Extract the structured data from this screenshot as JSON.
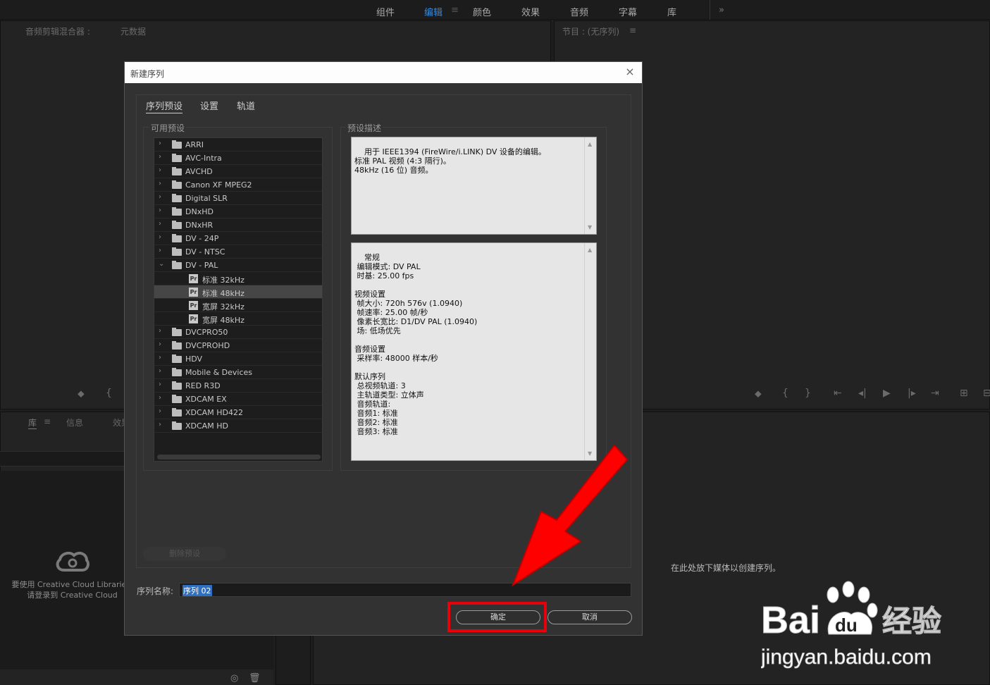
{
  "workspace_tabs": [
    "组件",
    "编辑",
    "颜色",
    "效果",
    "音频",
    "字幕",
    "库"
  ],
  "workspace_active": "编辑",
  "workspace_menu_icon": "≡",
  "workspace_more_icon": "»",
  "source_panel_header": {
    "tab1": "音频剪辑混合器 :",
    "tab2": "元数据"
  },
  "program_panel_header": "节目 : (无序列)",
  "program_menu_icon": "≡",
  "project_panel_tabs": [
    "库",
    "信息",
    "效果"
  ],
  "project_menu_icon": "≡",
  "cc_message": {
    "line1": "要使用 Creative Cloud Libraries,",
    "line2": "请登录到 Creative Cloud"
  },
  "timeline_drop_text": "在此处放下媒体以创建序列。",
  "dialog": {
    "title": "新建序列",
    "close_icon": "×",
    "tabs": [
      "序列预设",
      "设置",
      "轨道"
    ],
    "available_presets_label": "可用预设",
    "preset_description_label": "预设描述",
    "tree_items": [
      {
        "label": "ARRI",
        "type": "folder",
        "expanded": false
      },
      {
        "label": "AVC-Intra",
        "type": "folder",
        "expanded": false
      },
      {
        "label": "AVCHD",
        "type": "folder",
        "expanded": false
      },
      {
        "label": "Canon XF MPEG2",
        "type": "folder",
        "expanded": false
      },
      {
        "label": "Digital SLR",
        "type": "folder",
        "expanded": false
      },
      {
        "label": "DNxHD",
        "type": "folder",
        "expanded": false
      },
      {
        "label": "DNxHR",
        "type": "folder",
        "expanded": false
      },
      {
        "label": "DV - 24P",
        "type": "folder",
        "expanded": false
      },
      {
        "label": "DV - NTSC",
        "type": "folder",
        "expanded": false
      },
      {
        "label": "DV - PAL",
        "type": "folder",
        "expanded": true
      },
      {
        "label": "标准 32kHz",
        "type": "preset",
        "selected": false
      },
      {
        "label": "标准 48kHz",
        "type": "preset",
        "selected": true
      },
      {
        "label": "宽屏 32kHz",
        "type": "preset",
        "selected": false
      },
      {
        "label": "宽屏 48kHz",
        "type": "preset",
        "selected": false
      },
      {
        "label": "DVCPRO50",
        "type": "folder",
        "expanded": false
      },
      {
        "label": "DVCPROHD",
        "type": "folder",
        "expanded": false
      },
      {
        "label": "HDV",
        "type": "folder",
        "expanded": false
      },
      {
        "label": "Mobile & Devices",
        "type": "folder",
        "expanded": false
      },
      {
        "label": "RED R3D",
        "type": "folder",
        "expanded": false
      },
      {
        "label": "XDCAM EX",
        "type": "folder",
        "expanded": false
      },
      {
        "label": "XDCAM HD422",
        "type": "folder",
        "expanded": false
      },
      {
        "label": "XDCAM HD",
        "type": "folder",
        "expanded": false
      }
    ],
    "preset_icon_text": "Pr",
    "description_text": "用于 IEEE1394 (FireWire/i.LINK) DV 设备的编辑。\n标准 PAL 视频 (4:3 隔行)。\n48kHz (16 位) 音频。",
    "details_text": "常规\n 编辑模式: DV PAL\n 时基: 25.00 fps\n\n视频设置\n 帧大小: 720h 576v (1.0940)\n 帧速率: 25.00 帧/秒\n 像素长宽比: D1/DV PAL (1.0940)\n 场: 低场优先\n\n音频设置\n 采样率: 48000 样本/秒\n\n默认序列\n 总视频轨道: 3\n 主轨道类型: 立体声\n 音频轨道:\n 音频1: 标准\n 音频2: 标准\n 音频3: 标准",
    "delete_preset_button": "删除预设",
    "sequence_name_label": "序列名称:",
    "sequence_name_value": "序列 02",
    "ok_button": "确定",
    "cancel_button": "取消"
  },
  "watermark": {
    "brand": "Bai",
    "brand2": "经验",
    "url": "jingyan.baidu.com"
  },
  "colors": {
    "accent": "#2d8ceb",
    "highlight": "#e8000b",
    "arrow": "#ff0000"
  }
}
